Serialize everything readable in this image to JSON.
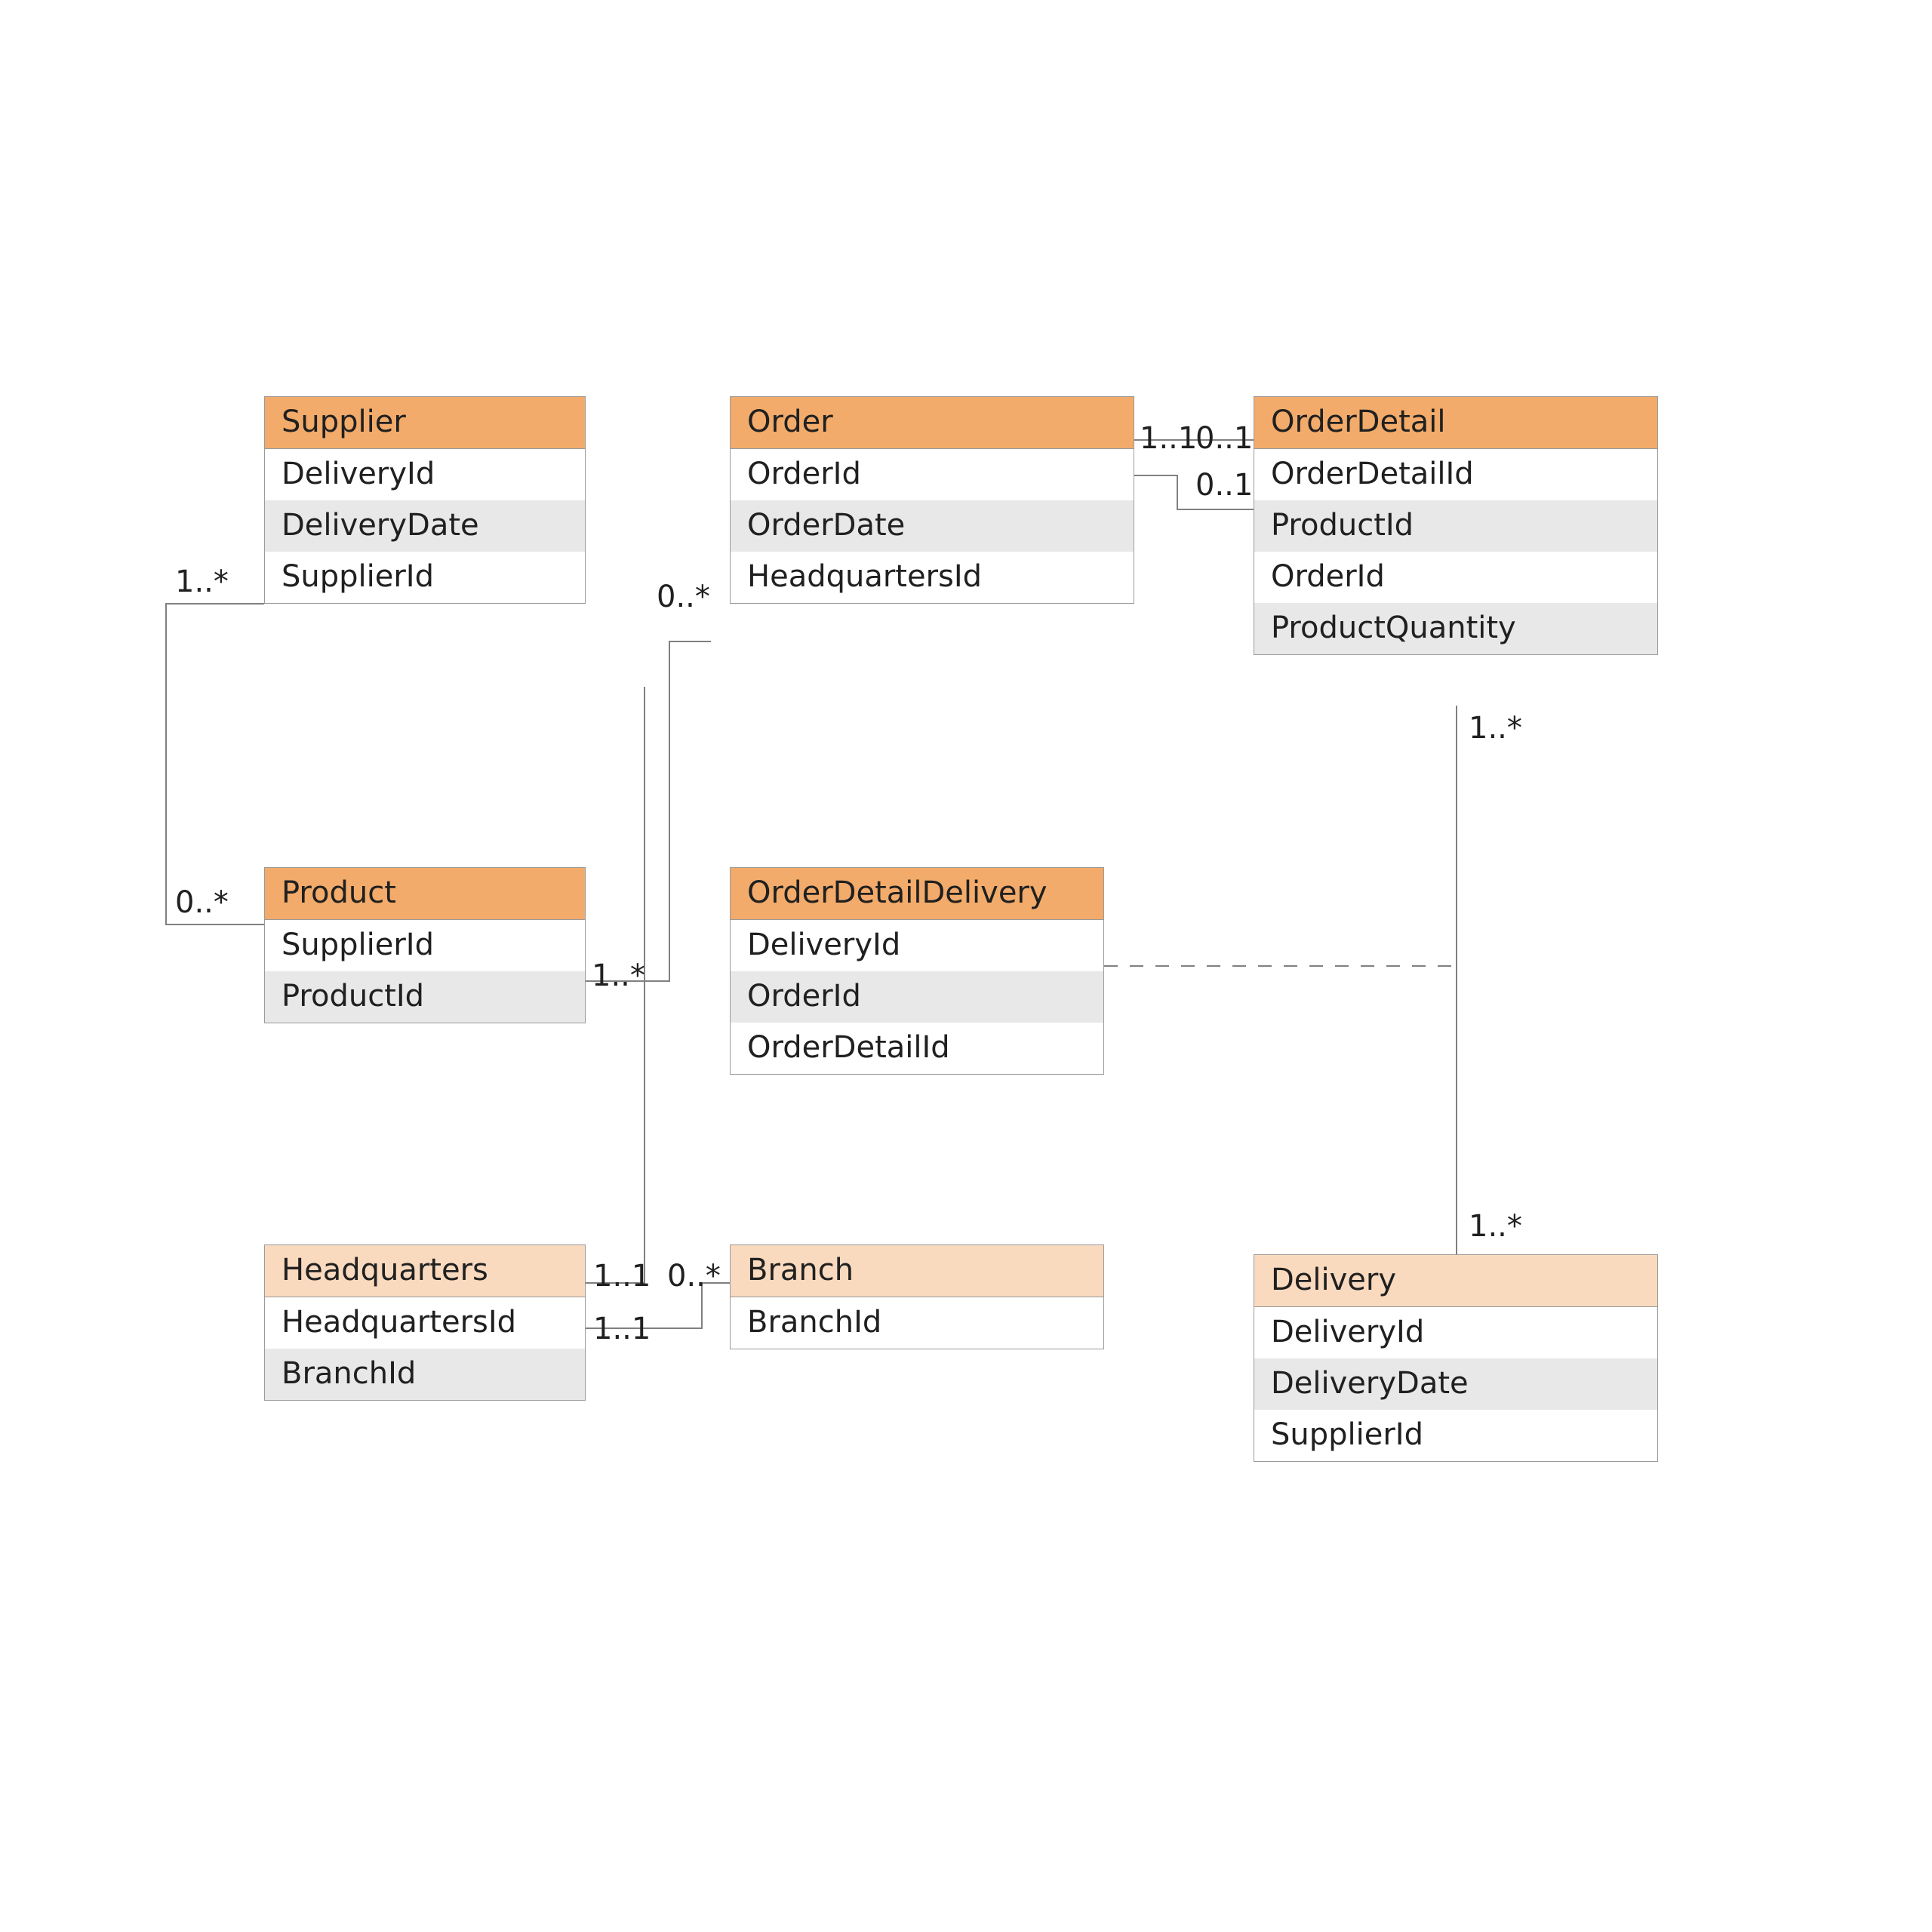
{
  "entities": {
    "supplier": {
      "title": "Supplier",
      "rows": [
        "DeliveryId",
        "DeliveryDate",
        "SupplierId"
      ]
    },
    "order": {
      "title": "Order",
      "rows": [
        "OrderId",
        "OrderDate",
        "HeadquartersId"
      ]
    },
    "orderDetail": {
      "title": "OrderDetail",
      "rows": [
        "OrderDetailId",
        "ProductId",
        "OrderId",
        "ProductQuantity"
      ]
    },
    "product": {
      "title": "Product",
      "rows": [
        "SupplierId",
        "ProductId"
      ]
    },
    "orderDetailDelivery": {
      "title": "OrderDetailDelivery",
      "rows": [
        "DeliveryId",
        "OrderId",
        "OrderDetailId"
      ]
    },
    "headquarters": {
      "title": "Headquarters",
      "rows": [
        "HeadquartersId",
        "BranchId"
      ]
    },
    "branch": {
      "title": "Branch",
      "rows": [
        "BranchId"
      ]
    },
    "delivery": {
      "title": "Delivery",
      "rows": [
        "DeliveryId",
        "DeliveryDate",
        "SupplierId"
      ]
    }
  },
  "multiplicities": {
    "supplier_1s": "1..*",
    "product_0s": "0..*",
    "product_1s_right": "1..*",
    "order_0s_left": "0..*",
    "order_11_right": "1..1",
    "orderDetail_01_top": "0..1",
    "orderDetail_01_lower": "0..1",
    "orderDetail_1s_bottom": "1..*",
    "headquarters_11_a": "1..1",
    "headquarters_11_b": "1..1",
    "branch_0s_left": "0..*",
    "delivery_1s_top": "1..*"
  }
}
